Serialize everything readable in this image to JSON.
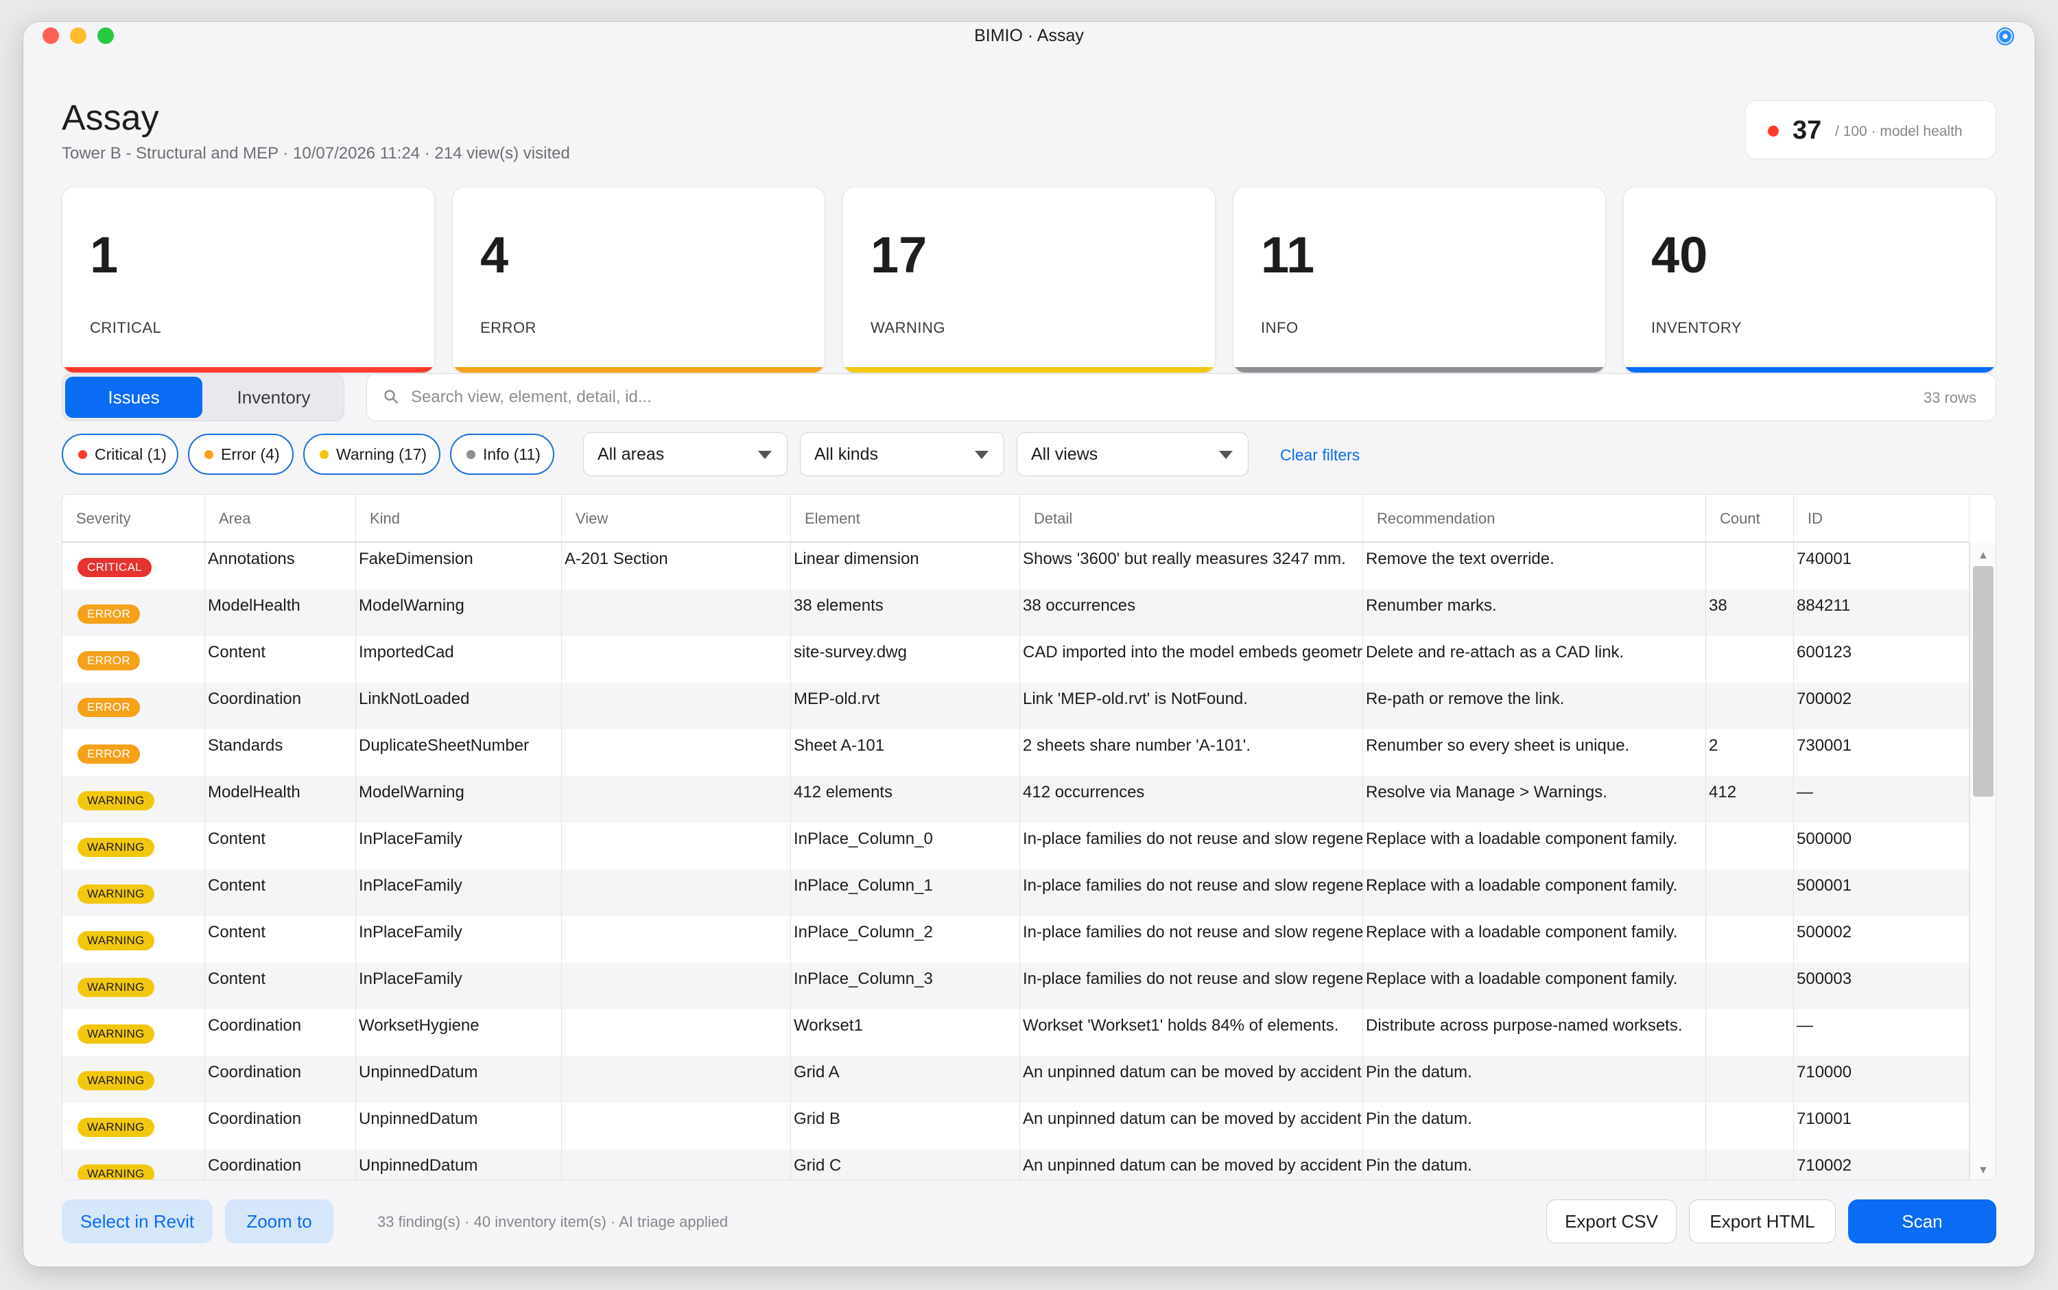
{
  "window": {
    "title": "BIMIO · Assay"
  },
  "header": {
    "title": "Assay",
    "subtitle": "Tower B - Structural and MEP · 10/07/2026 11:24 · 214 view(s) visited",
    "health": {
      "score": "37",
      "label": "/ 100 · model health",
      "color": "#ff3b30"
    }
  },
  "summary": [
    {
      "count": "1",
      "label": "CRITICAL",
      "color": "#ff3b30"
    },
    {
      "count": "4",
      "label": "ERROR",
      "color": "#f5a11a"
    },
    {
      "count": "17",
      "label": "WARNING",
      "color": "#f2c80f"
    },
    {
      "count": "11",
      "label": "INFO",
      "color": "#8e8e93"
    },
    {
      "count": "40",
      "label": "INVENTORY",
      "color": "#0a6cf5"
    }
  ],
  "tabs": {
    "issues": "Issues",
    "inventory": "Inventory",
    "active": "Issues"
  },
  "search": {
    "placeholder": "Search view, element, detail, id...",
    "rows": "33 rows"
  },
  "filters": {
    "chips": [
      {
        "label": "Critical (1)",
        "color": "#ff3b30"
      },
      {
        "label": "Error (4)",
        "color": "#f5a11a"
      },
      {
        "label": "Warning (17)",
        "color": "#f2c80f"
      },
      {
        "label": "Info (11)",
        "color": "#8e8e93"
      }
    ],
    "areas": "All areas",
    "kinds": "All kinds",
    "views": "All views",
    "clear": "Clear filters"
  },
  "table": {
    "columns": [
      "Severity",
      "Area",
      "Kind",
      "View",
      "Element",
      "Detail",
      "Recommendation",
      "Count",
      "ID"
    ],
    "rows": [
      {
        "severity": "CRITICAL",
        "area": "Annotations",
        "kind": "FakeDimension",
        "view": "A-201 Section",
        "element": "Linear dimension",
        "detail": "Shows '3600' but really measures 3247 mm.",
        "recommendation": "Remove the text override.",
        "count": "",
        "id": "740001"
      },
      {
        "severity": "ERROR",
        "area": "ModelHealth",
        "kind": "ModelWarning",
        "view": "",
        "element": "38 elements",
        "detail": "38 occurrences",
        "recommendation": "Renumber marks.",
        "count": "38",
        "id": "884211"
      },
      {
        "severity": "ERROR",
        "area": "Content",
        "kind": "ImportedCad",
        "view": "",
        "element": "site-survey.dwg",
        "detail": "CAD imported into the model embeds geometry",
        "recommendation": "Delete and re-attach as a CAD link.",
        "count": "",
        "id": "600123"
      },
      {
        "severity": "ERROR",
        "area": "Coordination",
        "kind": "LinkNotLoaded",
        "view": "",
        "element": "MEP-old.rvt",
        "detail": "Link 'MEP-old.rvt' is NotFound.",
        "recommendation": "Re-path or remove the link.",
        "count": "",
        "id": "700002"
      },
      {
        "severity": "ERROR",
        "area": "Standards",
        "kind": "DuplicateSheetNumber",
        "view": "",
        "element": "Sheet A-101",
        "detail": "2 sheets share number 'A-101'.",
        "recommendation": "Renumber so every sheet is unique.",
        "count": "2",
        "id": "730001"
      },
      {
        "severity": "WARNING",
        "area": "ModelHealth",
        "kind": "ModelWarning",
        "view": "",
        "element": "412 elements",
        "detail": "412 occurrences",
        "recommendation": "Resolve via Manage > Warnings.",
        "count": "412",
        "id": "—"
      },
      {
        "severity": "WARNING",
        "area": "Content",
        "kind": "InPlaceFamily",
        "view": "",
        "element": "InPlace_Column_0",
        "detail": "In-place families do not reuse and slow regeneration",
        "recommendation": "Replace with a loadable component family.",
        "count": "",
        "id": "500000"
      },
      {
        "severity": "WARNING",
        "area": "Content",
        "kind": "InPlaceFamily",
        "view": "",
        "element": "InPlace_Column_1",
        "detail": "In-place families do not reuse and slow regeneration",
        "recommendation": "Replace with a loadable component family.",
        "count": "",
        "id": "500001"
      },
      {
        "severity": "WARNING",
        "area": "Content",
        "kind": "InPlaceFamily",
        "view": "",
        "element": "InPlace_Column_2",
        "detail": "In-place families do not reuse and slow regeneration",
        "recommendation": "Replace with a loadable component family.",
        "count": "",
        "id": "500002"
      },
      {
        "severity": "WARNING",
        "area": "Content",
        "kind": "InPlaceFamily",
        "view": "",
        "element": "InPlace_Column_3",
        "detail": "In-place families do not reuse and slow regeneration",
        "recommendation": "Replace with a loadable component family.",
        "count": "",
        "id": "500003"
      },
      {
        "severity": "WARNING",
        "area": "Coordination",
        "kind": "WorksetHygiene",
        "view": "",
        "element": "Workset1",
        "detail": "Workset 'Workset1' holds 84% of elements.",
        "recommendation": "Distribute across purpose-named worksets.",
        "count": "",
        "id": "—"
      },
      {
        "severity": "WARNING",
        "area": "Coordination",
        "kind": "UnpinnedDatum",
        "view": "",
        "element": "Grid A",
        "detail": "An unpinned datum can be moved by accident",
        "recommendation": "Pin the datum.",
        "count": "",
        "id": "710000"
      },
      {
        "severity": "WARNING",
        "area": "Coordination",
        "kind": "UnpinnedDatum",
        "view": "",
        "element": "Grid B",
        "detail": "An unpinned datum can be moved by accident",
        "recommendation": "Pin the datum.",
        "count": "",
        "id": "710001"
      },
      {
        "severity": "WARNING",
        "area": "Coordination",
        "kind": "UnpinnedDatum",
        "view": "",
        "element": "Grid C",
        "detail": "An unpinned datum can be moved by accident",
        "recommendation": "Pin the datum.",
        "count": "",
        "id": "710002"
      }
    ]
  },
  "footer": {
    "select_in_revit": "Select in Revit",
    "zoom_to": "Zoom to",
    "status": "33 finding(s) · 40 inventory item(s) · AI triage applied",
    "export_csv": "Export CSV",
    "export_html": "Export HTML",
    "scan": "Scan"
  }
}
